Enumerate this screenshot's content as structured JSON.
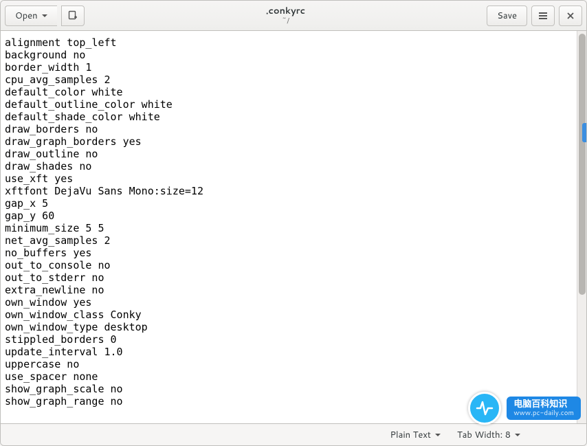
{
  "header": {
    "open_label": "Open",
    "save_label": "Save",
    "title": ".conkyrc",
    "subtitle": "~/"
  },
  "editor": {
    "content": "alignment top_left\nbackground no\nborder_width 1\ncpu_avg_samples 2\ndefault_color white\ndefault_outline_color white\ndefault_shade_color white\ndraw_borders no\ndraw_graph_borders yes\ndraw_outline no\ndraw_shades no\nuse_xft yes\nxftfont DejaVu Sans Mono:size=12\ngap_x 5\ngap_y 60\nminimum_size 5 5\nnet_avg_samples 2\nno_buffers yes\nout_to_console no\nout_to_stderr no\nextra_newline no\nown_window yes\nown_window_class Conky\nown_window_type desktop\nstippled_borders 0\nupdate_interval 1.0\nuppercase no\nuse_spacer none\nshow_graph_scale no\nshow_graph_range no"
  },
  "status": {
    "language": "Plain Text",
    "tab_width": "Tab Width: 8"
  },
  "watermark": {
    "line1": "电脑百科知识",
    "line2": "www.pc-daily.com"
  }
}
